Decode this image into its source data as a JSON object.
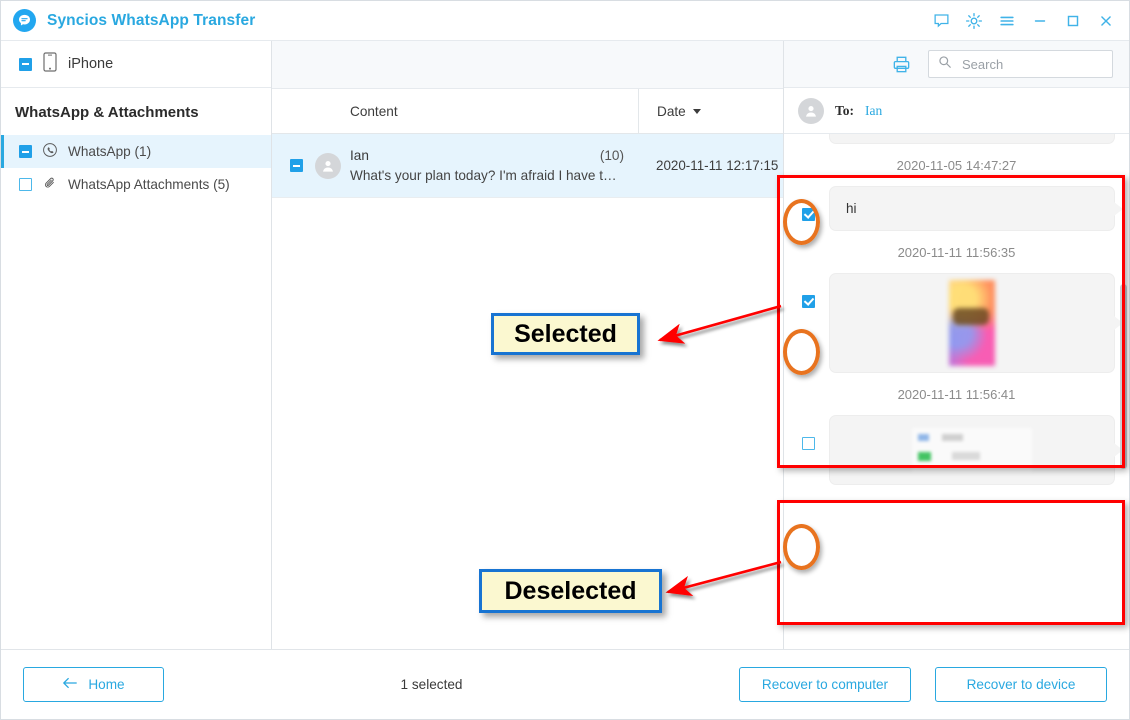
{
  "window": {
    "title": "Syncios WhatsApp Transfer",
    "controls": [
      {
        "name": "feedback-icon",
        "label": "Feedback"
      },
      {
        "name": "settings-icon",
        "label": "Settings"
      },
      {
        "name": "menu-icon",
        "label": "Menu"
      },
      {
        "name": "minimize-icon",
        "label": "Minimize"
      },
      {
        "name": "maximize-icon",
        "label": "Maximize"
      },
      {
        "name": "close-icon",
        "label": "Close"
      }
    ],
    "accent_color": "#29a8e0"
  },
  "sidebar": {
    "device": {
      "label": "iPhone",
      "checkbox_state": "indeterminate"
    },
    "section_title": "WhatsApp & Attachments",
    "items": [
      {
        "label": "WhatsApp (1)",
        "icon": "whatsapp-icon",
        "checkbox_state": "indeterminate",
        "active": true
      },
      {
        "label": "WhatsApp Attachments (5)",
        "icon": "paperclip-icon",
        "checkbox_state": "unchecked",
        "active": false
      }
    ]
  },
  "search": {
    "placeholder": "Search",
    "value": ""
  },
  "list": {
    "columns": [
      {
        "label": "Content"
      },
      {
        "label": "Date",
        "sort": "desc"
      }
    ],
    "rows": [
      {
        "checkbox_state": "indeterminate",
        "name": "Ian",
        "count": "(10)",
        "snippet": "What's your plan today? I'm afraid I have to sta...",
        "date": "2020-11-11 12:17:15",
        "selected": true
      }
    ]
  },
  "chat": {
    "to_label": "To:",
    "to_name": "Ian",
    "messages": [
      {
        "time": "",
        "type": "text",
        "text": "",
        "checkbox_state": "none",
        "partial": true
      },
      {
        "time": "2020-11-05 14:47:27",
        "type": "text",
        "text": "hi",
        "checkbox_state": "checked"
      },
      {
        "time": "2020-11-11 11:56:35",
        "type": "image",
        "text": "",
        "checkbox_state": "checked"
      },
      {
        "time": "2020-11-11 11:56:41",
        "type": "image",
        "text": "",
        "checkbox_state": "unchecked"
      }
    ]
  },
  "footer": {
    "home_label": "Home",
    "selected_text": "1 selected",
    "recover_computer_label": "Recover to computer",
    "recover_device_label": "Recover to device"
  },
  "annotations": {
    "selected_callout": "Selected",
    "deselected_callout": "Deselected",
    "box_color": "#ff0000",
    "ellipse_color": "#e8731f",
    "callout_fill": "#fbf8d0",
    "callout_border": "#1874d2",
    "arrow_color": "#ff0000"
  }
}
